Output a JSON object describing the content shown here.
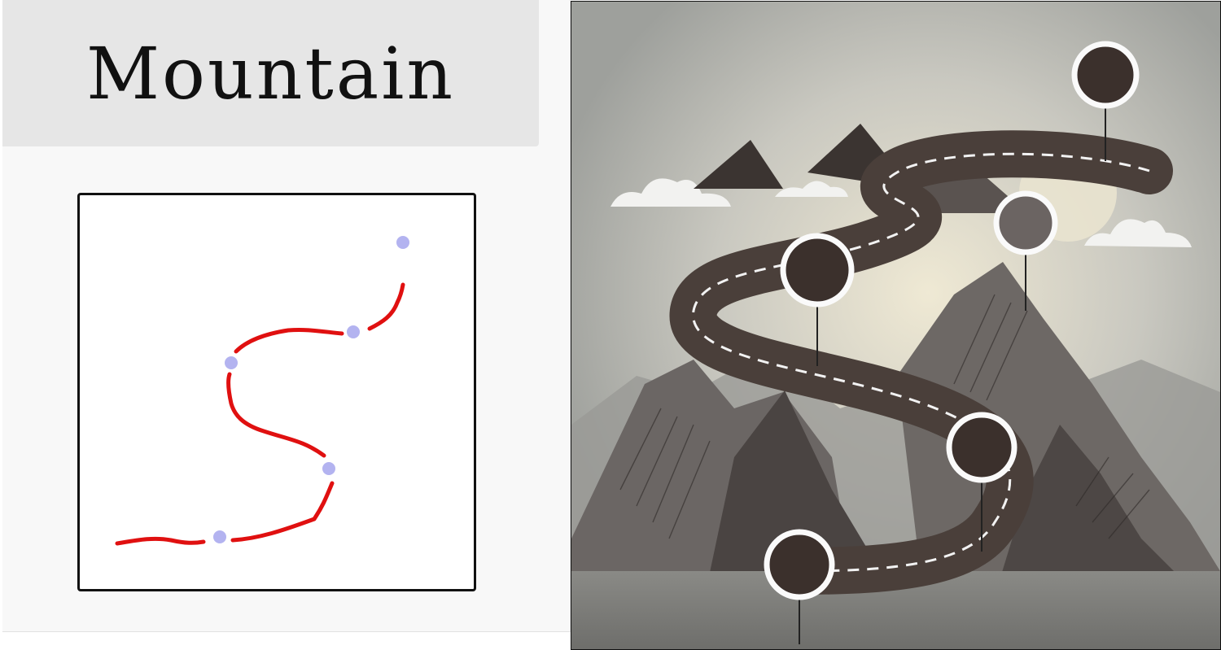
{
  "title": "Mountain",
  "colors": {
    "stroke": "#e01010",
    "dot": "#b3b3f0",
    "title_bar": "#e6e6e6",
    "road": "#4a3f3a",
    "sky": "#c7c7c0"
  }
}
